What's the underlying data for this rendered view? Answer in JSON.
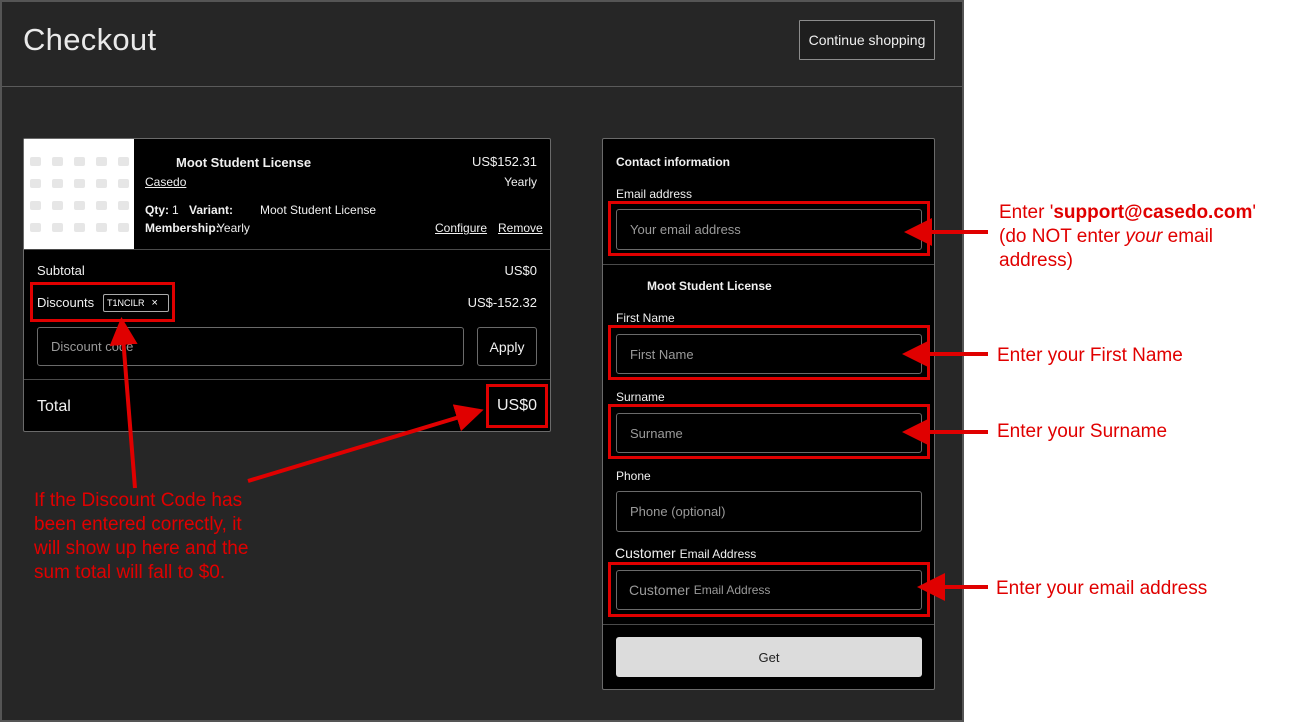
{
  "page": {
    "title": "Checkout",
    "continue_label": "Continue shopping"
  },
  "product": {
    "name": "Moot Student License",
    "vendor": "Casedo",
    "price": "US$152.31",
    "period": "Yearly",
    "qty_label": "Qty:",
    "qty_value": "1",
    "variant_label": "Variant:",
    "variant_value": "Moot Student License",
    "membership_label": "Membership:",
    "membership_value": "Yearly",
    "configure_label": "Configure",
    "remove_label": "Remove"
  },
  "summary": {
    "subtotal_label": "Subtotal",
    "subtotal_value": "US$0",
    "discounts_label": "Discounts",
    "discount_code": "T1NCILR",
    "discount_remove": "×",
    "discount_value": "US$-152.32",
    "discount_placeholder": "Discount code",
    "apply_label": "Apply",
    "total_label": "Total",
    "total_value": "US$0"
  },
  "form": {
    "contact_heading": "Contact information",
    "email_label": "Email address",
    "email_placeholder": "Your email address",
    "product_heading": "Moot Student License",
    "first_label": "First Name",
    "first_placeholder": "First Name",
    "surname_label": "Surname",
    "surname_placeholder": "Surname",
    "phone_label": "Phone",
    "phone_placeholder": "Phone (optional)",
    "customer_label_a": "Customer",
    "customer_label_b": "Email Address",
    "customer_placeholder_a": "Customer",
    "customer_placeholder_b": "Email Address",
    "get_label": "Get"
  },
  "annotations": {
    "email_note_pre": "Enter '",
    "email_note_bold": "support@casedo.com",
    "email_note_post": "'",
    "email_note_line2_pre": "(do NOT enter ",
    "email_note_line2_em": "your",
    "email_note_line2_post": " email",
    "email_note_line3": "address)",
    "first_note": "Enter your First Name",
    "surname_note": "Enter your Surname",
    "customer_note": "Enter your email address",
    "discount_note_1": "If the Discount Code has",
    "discount_note_2": "been entered correctly, it",
    "discount_note_3": "will show up here and the",
    "discount_note_4": "sum total will fall to $0."
  },
  "colors": {
    "annotation": "#e00000",
    "panel": "#000000",
    "background": "#262626"
  }
}
